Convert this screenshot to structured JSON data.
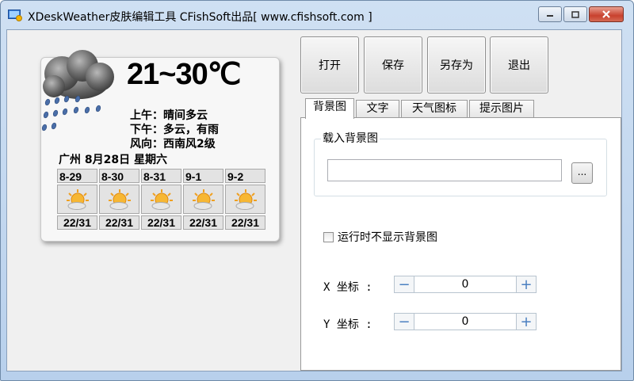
{
  "window": {
    "title": "XDeskWeather皮肤编辑工具    CFishSoft出品[ www.cfishsoft.com ]"
  },
  "weather": {
    "temperature": "21~30℃",
    "morning": "上午：晴间多云",
    "afternoon": "下午：多云，有雨",
    "wind": "风向：西南风2级",
    "city_date": "广州 8月28日 星期六",
    "forecast": [
      {
        "date": "8-29",
        "temp": "22/31",
        "icon": "sun-cloud-icon"
      },
      {
        "date": "8-30",
        "temp": "22/31",
        "icon": "sun-cloud-icon"
      },
      {
        "date": "8-31",
        "temp": "22/31",
        "icon": "sun-cloud-icon"
      },
      {
        "date": "9-1",
        "temp": "22/31",
        "icon": "sun-cloud-icon"
      },
      {
        "date": "9-2",
        "temp": "22/31",
        "icon": "sun-cloud-icon"
      }
    ]
  },
  "toolbar": {
    "open": "打开",
    "save": "保存",
    "save_as": "另存为",
    "exit": "退出"
  },
  "tabs": [
    "背景图",
    "文字",
    "天气图标",
    "提示图片"
  ],
  "background_panel": {
    "group_title": "载入背景图",
    "path_value": "",
    "browse_label": "...",
    "hide_bg_label": "运行时不显示背景图",
    "x_label": "X 坐标 :",
    "y_label": "Y 坐标 :",
    "x_value": "0",
    "y_value": "0",
    "minus": "−",
    "plus": "+"
  },
  "colors": {
    "titlebar": "#c4d9f1",
    "close_button": "#c8412e",
    "stepper_accent": "#4a7fc0"
  }
}
